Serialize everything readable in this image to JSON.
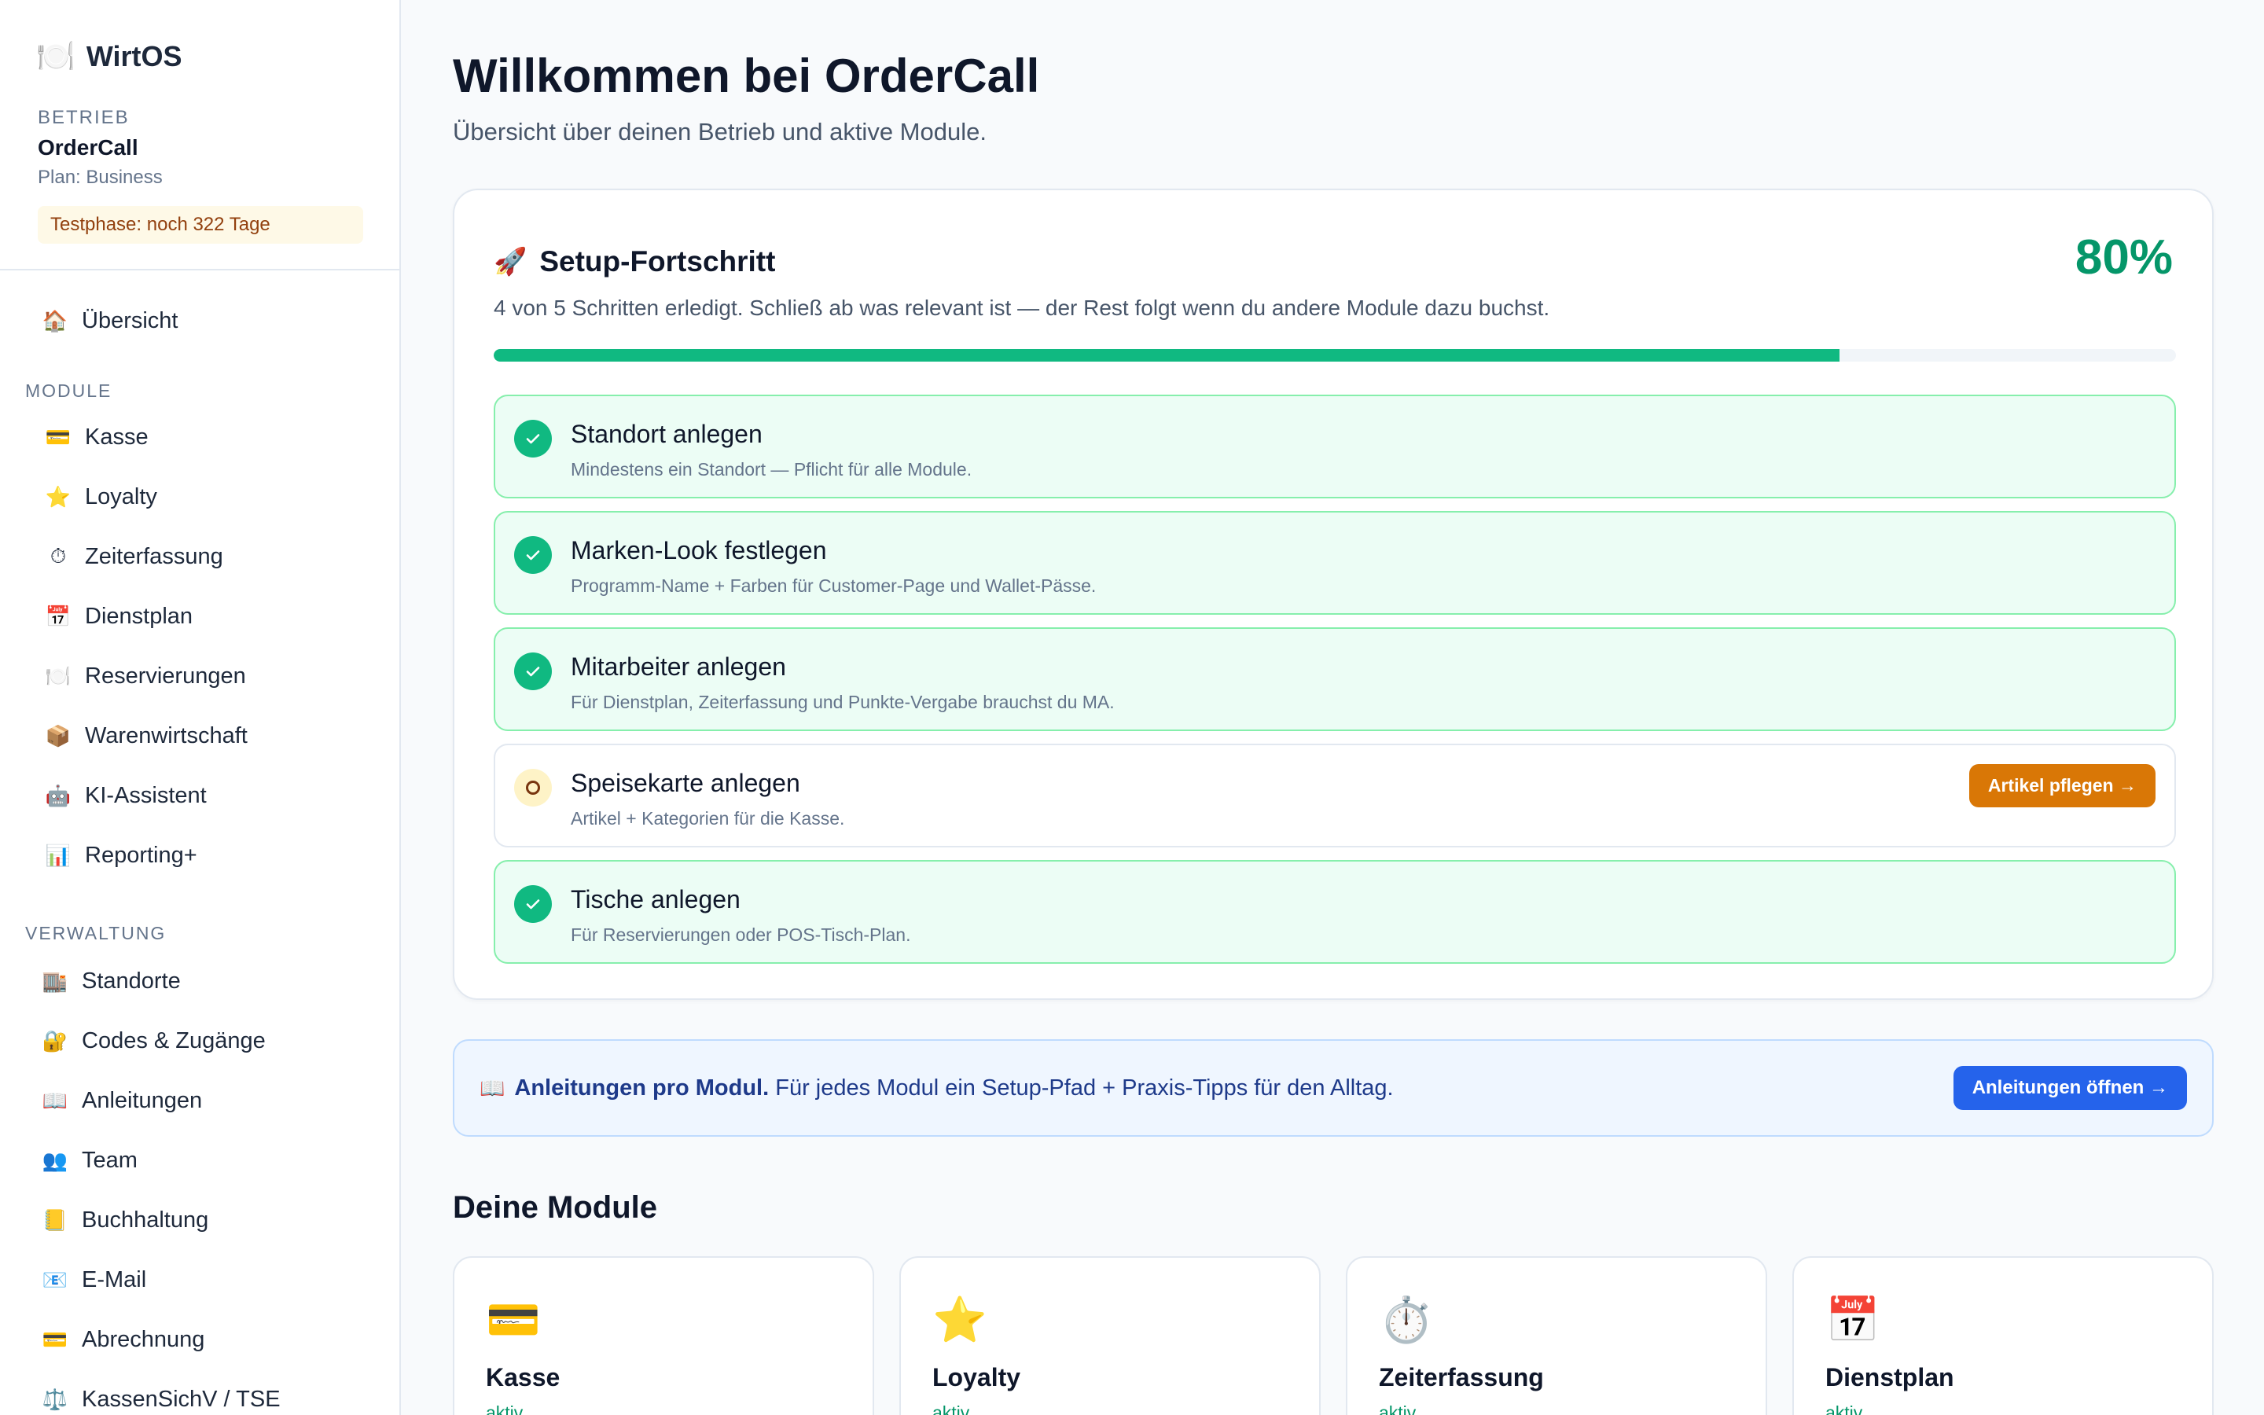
{
  "brand": {
    "icon": "🍽️",
    "name": "WirtOS"
  },
  "tenant": {
    "label": "BETRIEB",
    "name": "OrderCall",
    "plan": "Plan: Business",
    "trial": "Testphase: noch 322 Tage"
  },
  "nav": {
    "overview": {
      "icon": "🏠",
      "label": "Übersicht"
    },
    "section_modules": "MODULE",
    "modules": [
      {
        "icon": "💳",
        "label": "Kasse"
      },
      {
        "icon": "⭐",
        "label": "Loyalty"
      },
      {
        "icon": "⏱",
        "label": "Zeiterfassung"
      },
      {
        "icon": "📅",
        "label": "Dienstplan"
      },
      {
        "icon": "🍽️",
        "label": "Reservierungen"
      },
      {
        "icon": "📦",
        "label": "Warenwirtschaft"
      },
      {
        "icon": "🤖",
        "label": "KI-Assistent"
      },
      {
        "icon": "📊",
        "label": "Reporting+"
      }
    ],
    "section_admin": "VERWALTUNG",
    "admin": [
      {
        "icon": "🏬",
        "label": "Standorte"
      },
      {
        "icon": "🔐",
        "label": "Codes & Zugänge"
      },
      {
        "icon": "📖",
        "label": "Anleitungen"
      },
      {
        "icon": "👥",
        "label": "Team"
      },
      {
        "icon": "📒",
        "label": "Buchhaltung"
      },
      {
        "icon": "📧",
        "label": "E-Mail"
      },
      {
        "icon": "💳",
        "label": "Abrechnung"
      },
      {
        "icon": "⚖️",
        "label": "KassenSichV / TSE"
      }
    ]
  },
  "header": {
    "title": "Willkommen bei OrderCall",
    "subtitle": "Übersicht über deinen Betrieb und aktive Module."
  },
  "setup": {
    "icon": "🚀",
    "title": "Setup-Fortschritt",
    "percent_label": "80%",
    "progress": 0.8,
    "description": "4 von 5 Schritten erledigt. Schließ ab was relevant ist — der Rest folgt wenn du andere Module dazu buchst.",
    "steps": [
      {
        "title": "Standort anlegen",
        "desc": "Mindestens ein Standort — Pflicht für alle Module.",
        "done": true
      },
      {
        "title": "Marken-Look festlegen",
        "desc": "Programm-Name + Farben für Customer-Page und Wallet-Pässe.",
        "done": true
      },
      {
        "title": "Mitarbeiter anlegen",
        "desc": "Für Dienstplan, Zeiterfassung und Punkte-Vergabe brauchst du MA.",
        "done": true
      },
      {
        "title": "Speisekarte anlegen",
        "desc": "Artikel + Kategorien für die Kasse.",
        "done": false,
        "action": "Artikel pflegen →"
      },
      {
        "title": "Tische anlegen",
        "desc": "Für Reservierungen oder POS-Tisch-Plan.",
        "done": true
      }
    ]
  },
  "guides": {
    "icon": "📖",
    "bold": "Anleitungen pro Modul.",
    "text": "Für jedes Modul ein Setup-Pfad + Praxis-Tipps für den Alltag.",
    "button": "Anleitungen öffnen →"
  },
  "modules_section": {
    "title": "Deine Module",
    "cards": [
      {
        "icon": "💳",
        "name": "Kasse",
        "status": "aktiv"
      },
      {
        "icon": "⭐",
        "name": "Loyalty",
        "status": "aktiv"
      },
      {
        "icon": "⏱️",
        "name": "Zeiterfassung",
        "status": "aktiv"
      },
      {
        "icon": "📅",
        "name": "Dienstplan",
        "status": "aktiv"
      }
    ]
  },
  "colors": {
    "accent_green": "#10b981",
    "percent_green": "#059669",
    "warning_orange": "#d97706",
    "primary_blue": "#2563eb"
  }
}
